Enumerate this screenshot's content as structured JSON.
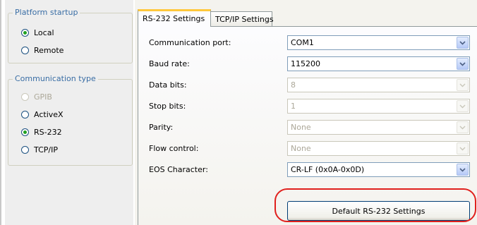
{
  "platform_startup": {
    "title": "Platform startup",
    "options": [
      {
        "label": "Local",
        "checked": true,
        "disabled": false
      },
      {
        "label": "Remote",
        "checked": false,
        "disabled": false
      }
    ]
  },
  "communication_type": {
    "title": "Communication type",
    "options": [
      {
        "label": "GPIB",
        "checked": false,
        "disabled": true
      },
      {
        "label": "ActiveX",
        "checked": false,
        "disabled": false
      },
      {
        "label": "RS-232",
        "checked": true,
        "disabled": false
      },
      {
        "label": "TCP/IP",
        "checked": false,
        "disabled": false
      }
    ]
  },
  "tabs": [
    {
      "label": "RS-232 Settings",
      "active": true
    },
    {
      "label": "TCP/IP Settings",
      "active": false
    }
  ],
  "settings": [
    {
      "label": "Communication port:",
      "value": "COM1",
      "disabled": false
    },
    {
      "label": "Baud rate:",
      "value": "115200",
      "disabled": false
    },
    {
      "label": "Data bits:",
      "value": "8",
      "disabled": true
    },
    {
      "label": "Stop bits:",
      "value": "1",
      "disabled": true
    },
    {
      "label": "Parity:",
      "value": "None",
      "disabled": true
    },
    {
      "label": "Flow control:",
      "value": "None",
      "disabled": true
    },
    {
      "label": "EOS Character:",
      "value": "CR-LF (0x0A-0x0D)",
      "disabled": false
    }
  ],
  "default_button": {
    "label": "Default RS-232 Settings"
  },
  "colors": {
    "highlight": "#e0201d",
    "group_title": "#3a6ea5",
    "active_tab_accent": "#ffc83c"
  }
}
